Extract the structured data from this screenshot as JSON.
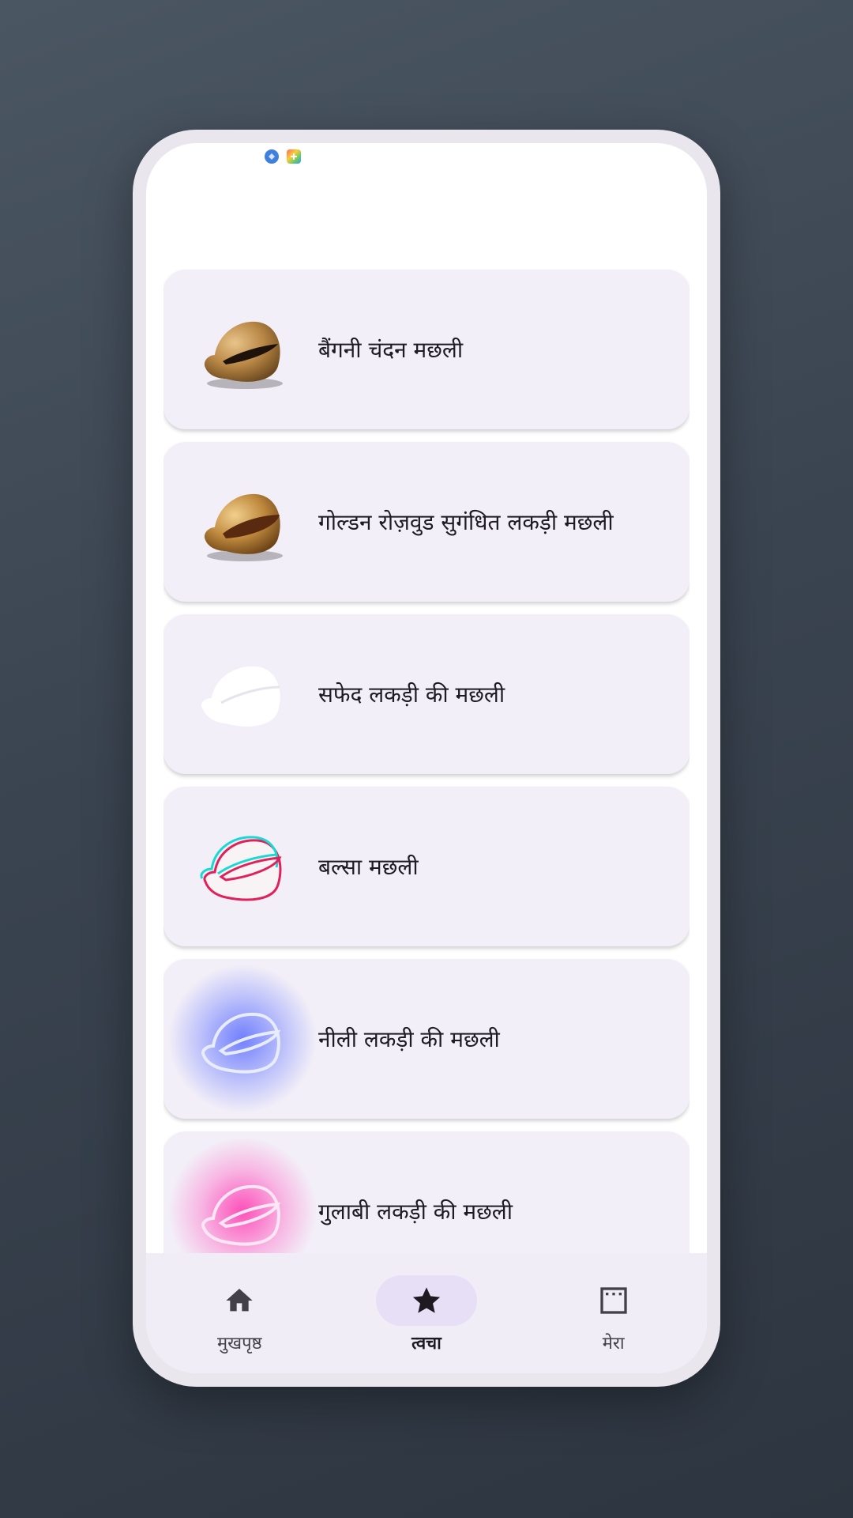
{
  "status_icons": [
    "vpn-icon",
    "app-notification-icon"
  ],
  "items": [
    {
      "label": "बैंगनी चंदन मछली",
      "icon": "brown-wooden-fish-icon"
    },
    {
      "label": "गोल्डन रोज़वुड सुगंधित लकड़ी मछली",
      "icon": "golden-wooden-fish-icon"
    },
    {
      "label": "सफेद लकड़ी की मछली",
      "icon": "white-wooden-fish-icon"
    },
    {
      "label": "बल्सा मछली",
      "icon": "rgb-outline-wooden-fish-icon"
    },
    {
      "label": "नीली लकड़ी की मछली",
      "icon": "blue-neon-wooden-fish-icon"
    },
    {
      "label": "गुलाबी लकड़ी की मछली",
      "icon": "pink-neon-wooden-fish-icon"
    }
  ],
  "nav": {
    "home": {
      "label": "मुखपृष्ठ",
      "icon": "home-icon"
    },
    "skin": {
      "label": "त्वचा",
      "icon": "star-icon",
      "active": true
    },
    "mine": {
      "label": "मेरा",
      "icon": "window-icon"
    }
  },
  "colors": {
    "card_bg": "#f3eff8",
    "active_pill": "#e6dff6",
    "nav_bg": "#f1edf6"
  }
}
